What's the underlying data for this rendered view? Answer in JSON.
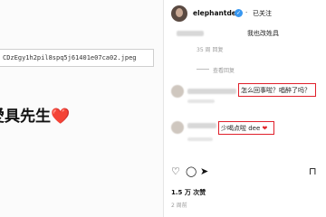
{
  "left": {
    "filename": "CDzEgy1h2pil8spq5j61401e07ca02.jpeg",
    "caption_text": "愛具先生",
    "caption_heart": "❤️"
  },
  "post": {
    "username": "elephantdee",
    "verified_glyph": "✓",
    "separator": "·",
    "follow_status": "已关注"
  },
  "comments": [
    {
      "text": "我也改姓具",
      "meta": "35 周 回复"
    },
    {
      "text": "怎么回事啦？唱醉了吗？"
    },
    {
      "text": "少喝点啦 dee",
      "heart": "❤"
    }
  ],
  "view_replies": "查看回复",
  "actions": {
    "like_icon": "heart-icon",
    "comment_icon": "comment-icon",
    "share_icon": "share-icon",
    "save_icon": "bookmark-icon"
  },
  "likes": "1.5 万 次赞",
  "date": "2 周前",
  "colors": {
    "highlight": "#e01f2a",
    "heart": "#e0262b",
    "verified": "#3897f0"
  }
}
